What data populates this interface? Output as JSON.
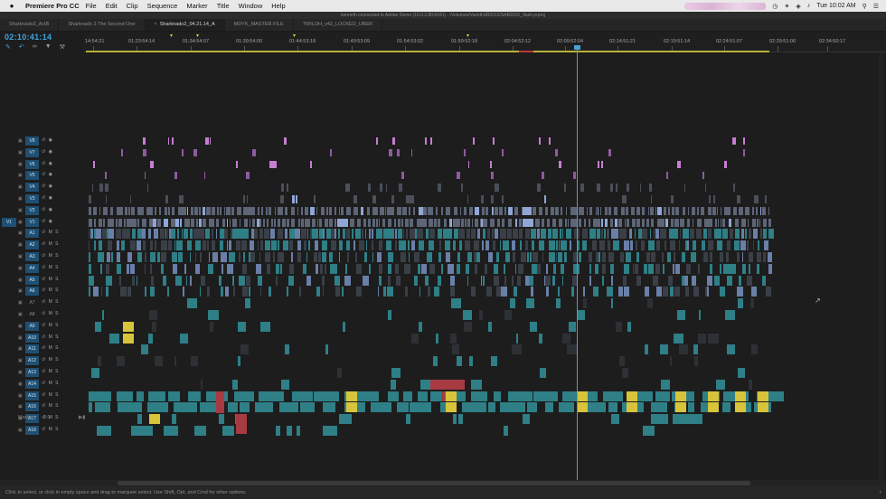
{
  "menubar": {
    "apple": "",
    "app_name": "Premiere Pro CC",
    "items": [
      "File",
      "Edit",
      "Clip",
      "Sequence",
      "Marker",
      "Title",
      "Window",
      "Help"
    ],
    "clock": "Tue 10:02 AM"
  },
  "window_title": "kenneth connected to Adobe Demo (10.0.2.80:8181) - /Volumes/VashthSB2015/SAB2015_Vash.prproj",
  "tabs": [
    {
      "label": "Sharknado2_ActB",
      "active": false
    },
    {
      "label": "Sharknado 2 The Second One",
      "active": false
    },
    {
      "label": "Sharknado2_04.21.14_A",
      "active": true
    },
    {
      "label": "MDYK_MASTER FILE",
      "active": false
    },
    {
      "label": "TWILOH_v42_LOCKED_UBER",
      "active": false
    }
  ],
  "timecode": "02:10:41:14",
  "ruler_labels": [
    "14:54:21",
    "01:23:54:14",
    "01:34:54:07",
    "01:39:54:00",
    "01:44:53:18",
    "01:49:53:09",
    "01:54:53:02",
    "01:59:52:18",
    "02:04:52:12",
    "02:09:52:04",
    "02:14:51:21",
    "02:19:51:14",
    "02:24:51:07",
    "02:29:51:00",
    "02:34:50:17"
  ],
  "video_tracks": [
    "V8",
    "V7",
    "V6",
    "V5",
    "V4",
    "V3",
    "V2",
    "V1"
  ],
  "audio_tracks": [
    "A1",
    "A2",
    "A3",
    "A4",
    "A5",
    "A6",
    "A7",
    "A8",
    "A9",
    "A10",
    "A11",
    "A12",
    "A13",
    "A14",
    "A15",
    "A16",
    "A17",
    "A18"
  ],
  "source_patch": "V1",
  "master": {
    "label": "Master",
    "value": "0.0"
  },
  "status_bar": "Click to select, or click in empty space and drag to marquee select. Use Shift, Opt, and Cmd for other options.",
  "colors": {
    "accent": "#3fa3e0",
    "audio_clip": "#2f7f87",
    "video_clip": "#8fa6d6",
    "pink_clip": "#c67ed1",
    "red_clip": "#a83a42",
    "label_yellow": "#d7c43b"
  }
}
